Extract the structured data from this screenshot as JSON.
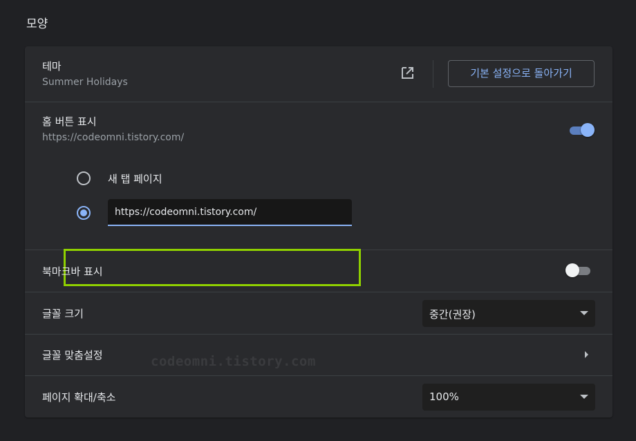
{
  "section": {
    "title": "모양"
  },
  "theme": {
    "label": "테마",
    "value": "Summer Holidays",
    "open_icon": "open-in-new-icon",
    "reset_label": "기본 설정으로 돌아가기"
  },
  "home_button": {
    "label": "홈 버튼 표시",
    "url": "https://codeomni.tistory.com/",
    "toggle_on": true,
    "option_new_tab": "새 탭 페이지",
    "option_custom_url_value": "https://codeomni.tistory.com/"
  },
  "bookmark_bar": {
    "label": "북마크바 표시",
    "toggle_on": false
  },
  "font_size": {
    "label": "글꼴 크기",
    "selected": "중간(권장)"
  },
  "fonts_custom": {
    "label": "글꼴 맞춤설정"
  },
  "page_zoom": {
    "label": "페이지 확대/축소",
    "selected": "100%"
  },
  "watermark": "codeomni.tistory.com",
  "colors": {
    "accent": "#8ab4f8",
    "highlight_border": "#8fd000",
    "background": "#202124",
    "card": "#292a2d"
  }
}
